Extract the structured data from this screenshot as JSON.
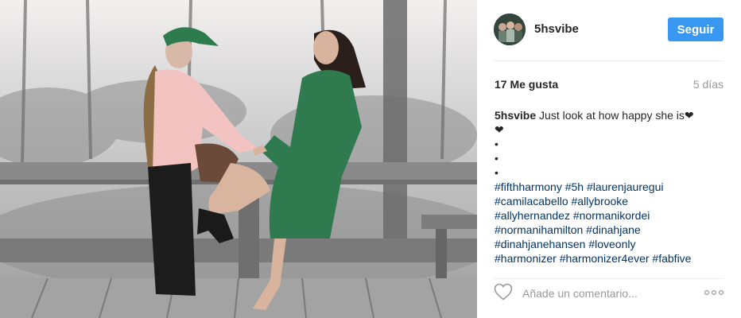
{
  "post": {
    "image_alt": "two girls on a wooden bridge in a forest",
    "colors": {
      "accent": "#3897f0",
      "hashtag": "#003569",
      "muted": "#999999",
      "text": "#262626",
      "coat_green": "#2f7a4f",
      "cap_green": "#2e7b4e"
    }
  },
  "header": {
    "username": "5hsvibe",
    "follow_label": "Seguir",
    "avatar_icon": "avatar-photo"
  },
  "meta": {
    "likes": "17 Me gusta",
    "time": "5 días"
  },
  "caption": {
    "username": "5hsvibe",
    "text": " Just look at how happy she is❤",
    "lines": [
      "❤",
      "•",
      "•",
      "•"
    ],
    "hashtag_lines": [
      "#fifthharmony #5h #laurenjauregui",
      "#camilacabello #allybrooke",
      "#allyhernandez #normanikordei",
      "#normanihamilton #dinahjane",
      "#dinahjanehansen #loveonly",
      "#harmonizer #harmonizer4ever #fabfive"
    ]
  },
  "comment": {
    "placeholder": "Añade un comentario...",
    "like_icon": "heart-outline-icon",
    "more_icon": "more-options-icon"
  }
}
